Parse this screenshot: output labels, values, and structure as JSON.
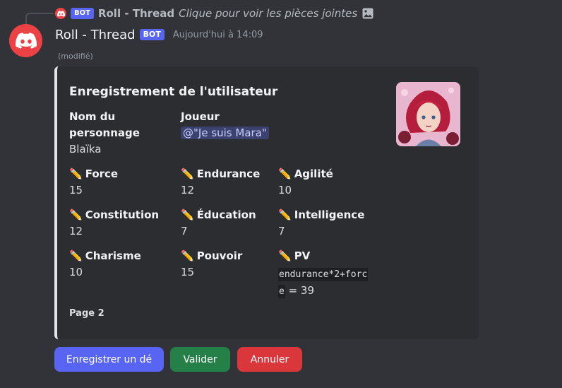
{
  "reply": {
    "username": "Roll - Thread",
    "bot_tag": "BOT",
    "snippet": "Clique pour voir les pièces jointes",
    "icon": "image-icon"
  },
  "message": {
    "username": "Roll - Thread",
    "bot_tag": "BOT",
    "timestamp": "Aujourd'hui à 14:09",
    "edited": "(modifié)",
    "avatar_color": "#ed4245"
  },
  "embed": {
    "title": "Enregistrement de l'utilisateur",
    "border_color": "#e3e5e8",
    "footer": "Page 2",
    "name_field": {
      "label": "Nom du\npersonnage",
      "value": "Blaïka"
    },
    "player_field": {
      "label": "Joueur",
      "value": "@\"Je suis Mara\""
    },
    "stats": [
      {
        "emoji": "✏️",
        "label": "Force",
        "value": "15"
      },
      {
        "emoji": "✏️",
        "label": "Endurance",
        "value": "12"
      },
      {
        "emoji": "✏️",
        "label": "Agilité",
        "value": "10"
      },
      {
        "emoji": "✏️",
        "label": "Constitution",
        "value": "12"
      },
      {
        "emoji": "✏️",
        "label": "Éducation",
        "value": "7"
      },
      {
        "emoji": "✏️",
        "label": "Intelligence",
        "value": "7"
      },
      {
        "emoji": "✏️",
        "label": "Charisme",
        "value": "10"
      },
      {
        "emoji": "✏️",
        "label": "Pouvoir",
        "value": "15"
      },
      {
        "emoji": "✏️",
        "label": "PV",
        "code_line1": "endurance*2+forc",
        "code_line2": "e",
        "result": " = 39"
      }
    ]
  },
  "buttons": [
    {
      "label": "Enregistrer un dé",
      "color": "#5865f2"
    },
    {
      "label": "Valider",
      "color": "#248046"
    },
    {
      "label": "Annuler",
      "color": "#da373c"
    }
  ]
}
